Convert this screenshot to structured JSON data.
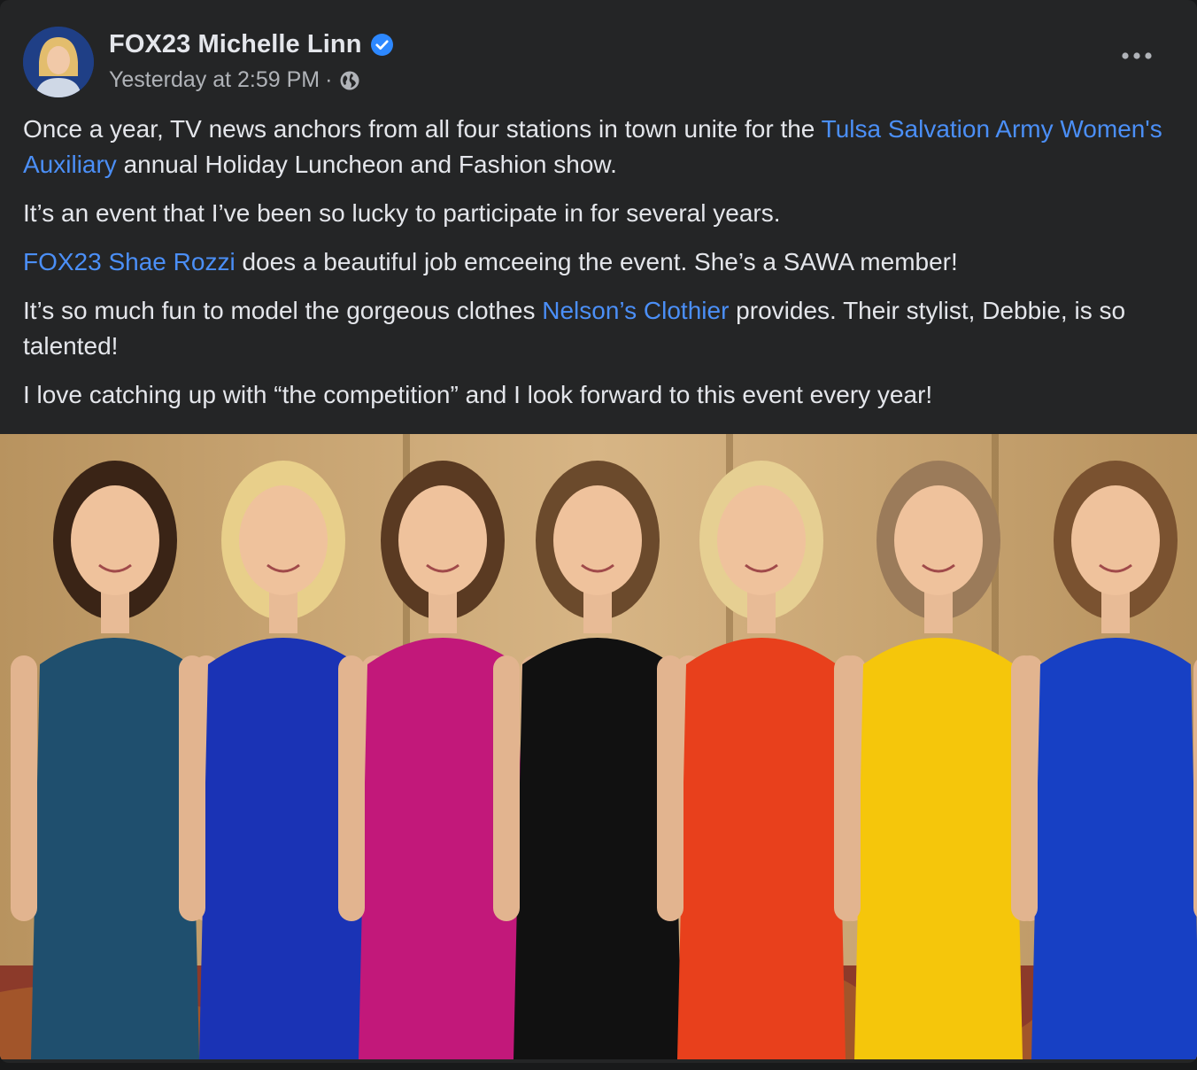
{
  "post": {
    "author": "FOX23 Michelle Linn",
    "timestamp": "Yesterday at 2:59 PM",
    "separator": "·",
    "privacy_icon": "globe-icon",
    "verified_icon": "verified-badge-icon",
    "more_icon": "more-options-icon",
    "paragraphs": {
      "p1": {
        "before": "Once a year, TV news anchors from all four stations in town unite for the ",
        "link": "Tulsa Salvation Army Women's Auxiliary",
        "after": " annual Holiday Luncheon and Fashion show."
      },
      "p2": {
        "text": "It’s an event that I’ve been so lucky to participate in for several years."
      },
      "p3": {
        "link": "FOX23 Shae Rozzi",
        "after": " does a beautiful job emceeing the event. She’s a SAWA member!"
      },
      "p4": {
        "before": "It’s so much fun to model the gorgeous clothes ",
        "link": "Nelson’s Clothier",
        "after": " provides. Their stylist, Debbie, is so talented!"
      },
      "p5": {
        "text": "I love catching up with “the competition” and I look forward to this event every year!"
      }
    },
    "colors": {
      "background": "#242526",
      "text": "#e4e6eb",
      "secondary_text": "#b0b3b8",
      "link": "#4b8ff7",
      "verified": "#2d88ff"
    },
    "photo": {
      "dress_colors": [
        "#1f4f6e",
        "#1a33b5",
        "#c2187a",
        "#111111",
        "#e8401c",
        "#f5c60b",
        "#1740c4"
      ]
    }
  }
}
